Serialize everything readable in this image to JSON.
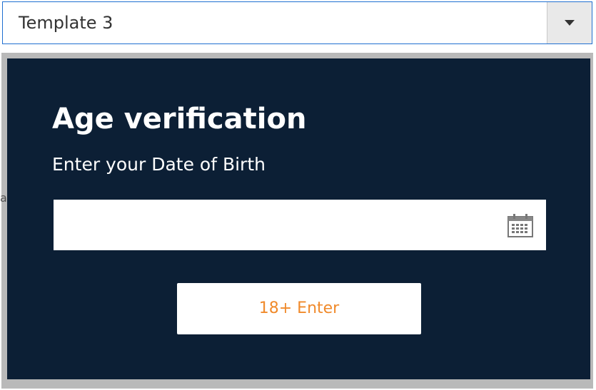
{
  "template_select": {
    "selected_value": "Template 3",
    "arrow_icon": "chevron-down-icon"
  },
  "popup": {
    "title": "Age verification",
    "subtitle": "Enter your Date of Birth",
    "date_input": {
      "value": "",
      "placeholder": "",
      "icon": "calendar-icon"
    },
    "enter_button_label": "18+ Enter",
    "colors": {
      "background": "#0c1f35",
      "button_text": "#f08a2b",
      "text": "#ffffff"
    }
  },
  "edge_text": "a"
}
